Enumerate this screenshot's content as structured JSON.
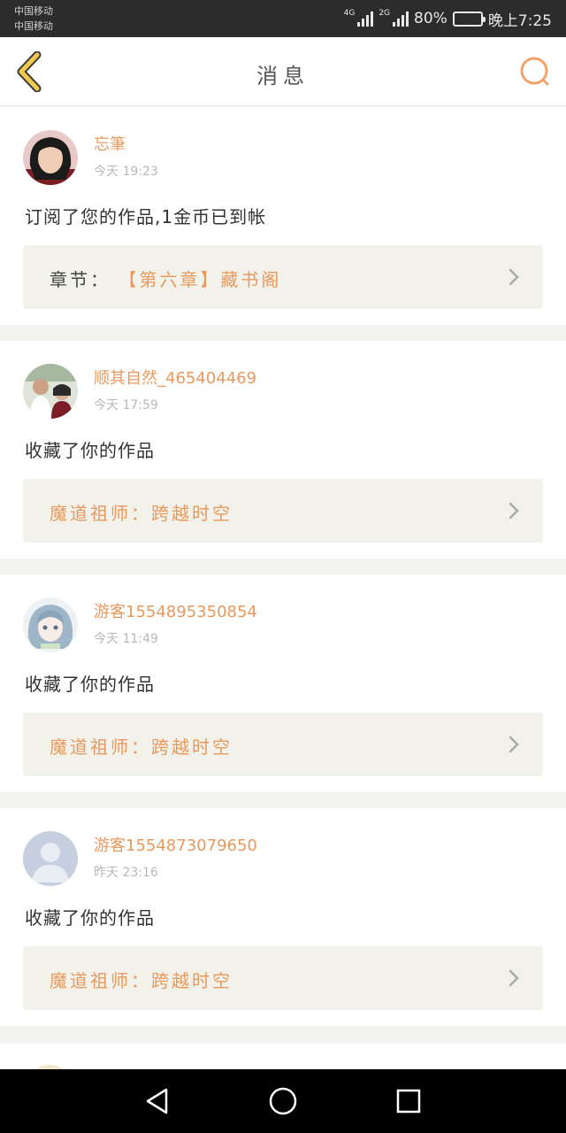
{
  "status_bar": {
    "carrier_1": "中国移动",
    "carrier_2": "中国移动",
    "net_1": "4G",
    "net_2": "2G",
    "battery": "80%",
    "battery_level": 0.8,
    "time": "晚上7:25"
  },
  "header": {
    "title": "消息",
    "back_icon": "back-arrow-icon",
    "search_icon": "search-icon"
  },
  "colors": {
    "accent": "#e8995e",
    "back_arrow": "#f2c94c",
    "card_link_bg": "#f2f2ea"
  },
  "messages": [
    {
      "user": "忘筆",
      "time": "今天 19:23",
      "text": "订阅了您的作品,1金币已到帐",
      "link_prefix": "章节：",
      "link_title": "【第六章】藏书阁"
    },
    {
      "user": "顺其自然_465404469",
      "time": "今天 17:59",
      "text": "收藏了你的作品",
      "link_title": "魔道祖师：跨越时空"
    },
    {
      "user": "游客1554895350854",
      "time": "今天 11:49",
      "text": "收藏了你的作品",
      "link_title": "魔道祖师：跨越时空"
    },
    {
      "user": "游客1554873079650",
      "time": "昨天 23:16",
      "text": "收藏了你的作品",
      "link_title": "魔道祖师：跨越时空"
    }
  ],
  "nav_bar": {
    "back": "triangle-back-icon",
    "home": "circle-home-icon",
    "recents": "square-recents-icon"
  }
}
